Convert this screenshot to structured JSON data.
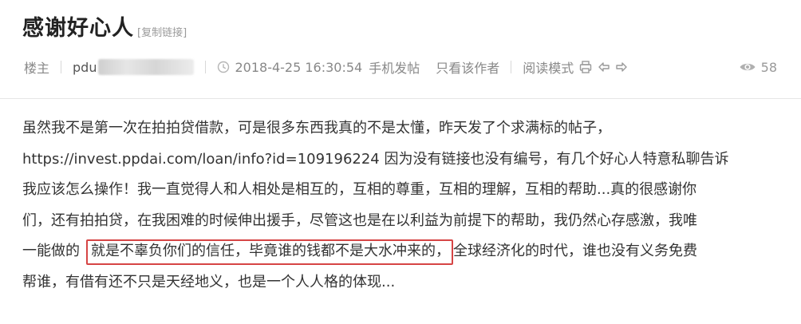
{
  "post": {
    "title": "感谢好心人",
    "copy_link": "[复制链接]"
  },
  "meta": {
    "role": "楼主",
    "author": "pdu",
    "datetime": "2018-4-25 16:30:54",
    "source": "手机发帖",
    "only_author": "只看该作者",
    "read_mode": "阅读模式",
    "views": "58"
  },
  "body": {
    "line1": "虽然我不是第一次在拍拍贷借款，可是很多东西我真的不是太懂，昨天发了个求满标的帖子，",
    "line2": "https://invest.ppdai.com/loan/info?id=109196224 因为没有链接也没有编号，有几个好心人特意私聊告诉",
    "line3": "我应该怎么操作！我一直觉得人和人相处是相互的，互相的尊重，互相的理解，互相的帮助...真的很感谢你",
    "line4": "们，还有拍拍贷，在我困难的时候伸出援手，尽管这也是在以利益为前提下的帮助，我仍然心存感激，我唯",
    "line5_before": "一能做的",
    "line5_highlight": "就是不辜负你们的信任，毕竟谁的钱都不是大水冲来的，",
    "line5_after": "全球经济化的时代，谁也没有义务免费",
    "line6": "帮谁，有借有还不只是天经地义，也是一个人人格的体现..."
  },
  "colors": {
    "highlight_border": "#d64545"
  },
  "icons": [
    "clock-icon",
    "print-icon",
    "prev-arrow-icon",
    "next-arrow-icon",
    "eye-icon"
  ]
}
